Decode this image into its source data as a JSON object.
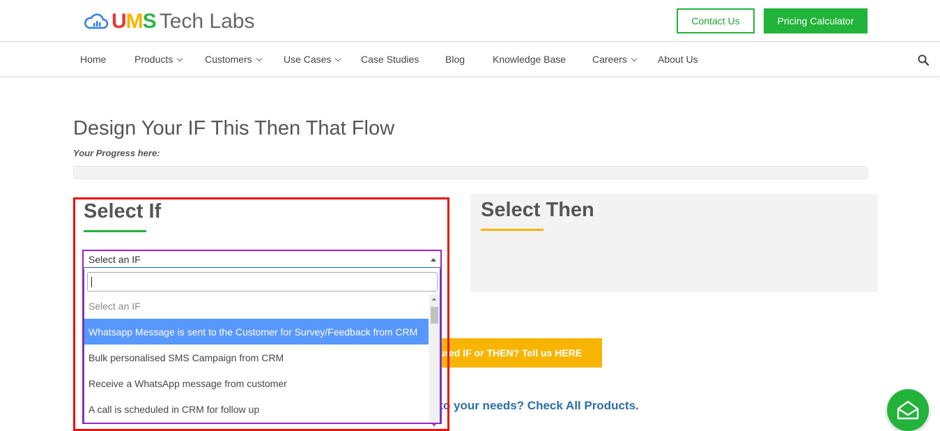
{
  "header": {
    "logo": {
      "part1_u": "U",
      "part1_m": "M",
      "part1_s": "S",
      "part2": "Tech Labs"
    },
    "contact_label": "Contact Us",
    "pricing_label": "Pricing Calculator"
  },
  "nav": {
    "items": [
      {
        "label": "Home",
        "dropdown": false
      },
      {
        "label": "Products",
        "dropdown": true
      },
      {
        "label": "Customers",
        "dropdown": true
      },
      {
        "label": "Use Cases",
        "dropdown": true
      },
      {
        "label": "Case Studies",
        "dropdown": false
      },
      {
        "label": "Blog",
        "dropdown": false
      },
      {
        "label": "Knowledge Base",
        "dropdown": false
      },
      {
        "label": "Careers",
        "dropdown": true
      },
      {
        "label": "About Us",
        "dropdown": false
      }
    ],
    "search_icon": "search-icon"
  },
  "main": {
    "title": "Design Your IF This Then That Flow",
    "progress_label": "Your Progress here:",
    "progress_value": 0,
    "if_section": {
      "title": "Select If",
      "select_value": "Select an IF",
      "search_value": "",
      "options": [
        "Select an IF",
        "Whatsapp Message is sent to the Customer for Survey/Feedback from CRM",
        "Bulk personalised SMS Campaign from CRM",
        "Receive a WhatsApp message from customer",
        "A call is scheduled in CRM for follow up"
      ],
      "highlighted_index": 1
    },
    "then_section": {
      "title": "Select Then"
    },
    "tell_us_text": "ured IF or THEN? Tell us HERE",
    "products_text": "ant to your needs? Check All Products."
  },
  "colors": {
    "brand_green": "#22b33a",
    "accent_yellow": "#f7b500",
    "highlight_blue": "#5897fb",
    "annotation_red": "#ee1111",
    "annotation_purple": "#a020c8"
  },
  "floating_button_icon": "envelope-icon"
}
